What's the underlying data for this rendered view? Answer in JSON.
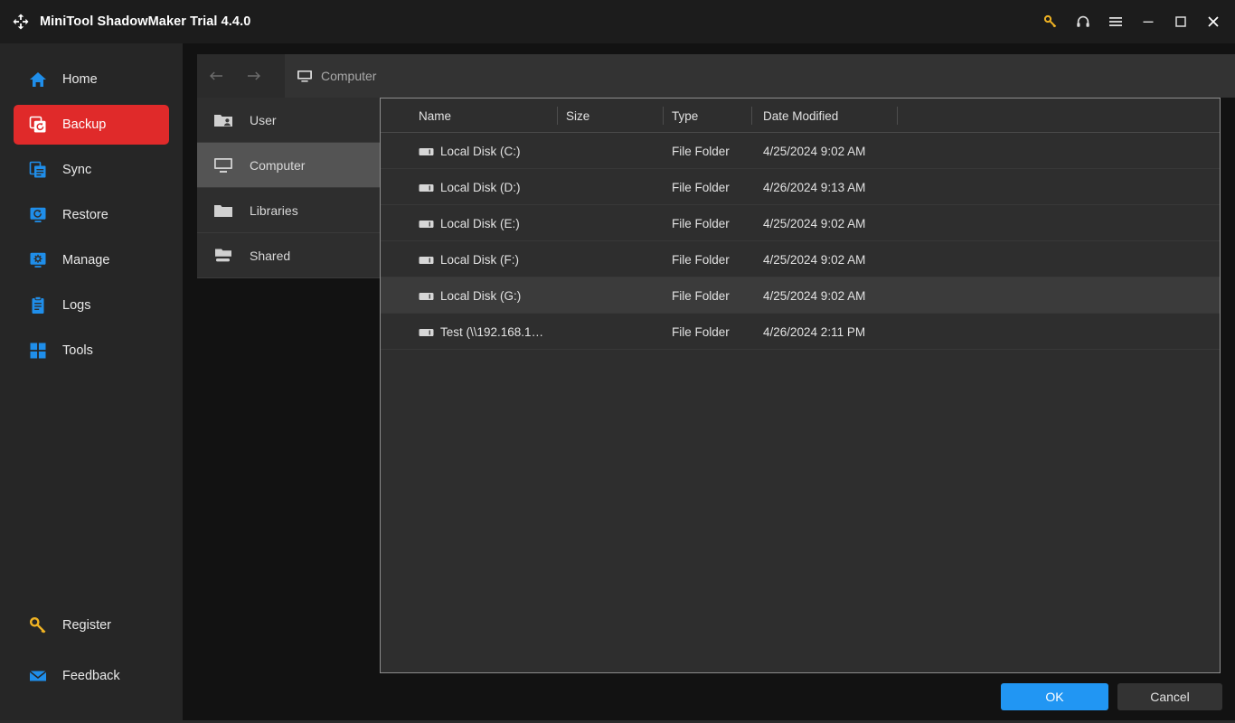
{
  "window": {
    "title": "MiniTool ShadowMaker Trial 4.4.0",
    "logo_icon": "refresh-arrows-icon",
    "controls": [
      {
        "name": "key-icon",
        "label": "Register",
        "color": "#f0b323"
      },
      {
        "name": "headset-icon",
        "label": "Support",
        "color": "#dcdcdc"
      },
      {
        "name": "hamburger-icon",
        "label": "Menu",
        "color": "#dcdcdc"
      },
      {
        "name": "minimize-icon",
        "label": "Minimize",
        "color": "#dcdcdc"
      },
      {
        "name": "maximize-icon",
        "label": "Maximize",
        "color": "#dcdcdc"
      },
      {
        "name": "close-icon",
        "label": "Close",
        "color": "#ffffff"
      }
    ]
  },
  "sidebar": {
    "items": [
      {
        "label": "Home",
        "icon": "home-icon",
        "active": false
      },
      {
        "label": "Backup",
        "icon": "backup-icon",
        "active": true
      },
      {
        "label": "Sync",
        "icon": "sync-icon",
        "active": false
      },
      {
        "label": "Restore",
        "icon": "restore-icon",
        "active": false
      },
      {
        "label": "Manage",
        "icon": "manage-icon",
        "active": false
      },
      {
        "label": "Logs",
        "icon": "logs-icon",
        "active": false
      },
      {
        "label": "Tools",
        "icon": "tools-icon",
        "active": false
      }
    ],
    "bottom_items": [
      {
        "label": "Register",
        "icon": "key-icon"
      },
      {
        "label": "Feedback",
        "icon": "envelope-icon"
      }
    ],
    "active_color": "#e02a2a",
    "icon_color": "#1f8eea"
  },
  "navbar": {
    "back_icon": "arrow-left-icon",
    "forward_icon": "arrow-right-icon",
    "path_icon": "monitor-icon",
    "path_text": "Computer"
  },
  "tree": {
    "items": [
      {
        "label": "User",
        "icon": "folder-user-icon",
        "selected": false
      },
      {
        "label": "Computer",
        "icon": "monitor-icon",
        "selected": true
      },
      {
        "label": "Libraries",
        "icon": "folder-icon",
        "selected": false
      },
      {
        "label": "Shared",
        "icon": "shared-folder-icon",
        "selected": false
      }
    ]
  },
  "filelist": {
    "columns": [
      "Name",
      "Size",
      "Type",
      "Date Modified"
    ],
    "rows": [
      {
        "name": "Local Disk (C:)",
        "size": "",
        "type": "File Folder",
        "date": "4/25/2024 9:02 AM",
        "icon": "hard-drive-icon",
        "hover": false
      },
      {
        "name": "Local Disk (D:)",
        "size": "",
        "type": "File Folder",
        "date": "4/26/2024 9:13 AM",
        "icon": "hard-drive-icon",
        "hover": false
      },
      {
        "name": "Local Disk (E:)",
        "size": "",
        "type": "File Folder",
        "date": "4/25/2024 9:02 AM",
        "icon": "hard-drive-icon",
        "hover": false
      },
      {
        "name": "Local Disk (F:)",
        "size": "",
        "type": "File Folder",
        "date": "4/25/2024 9:02 AM",
        "icon": "hard-drive-icon",
        "hover": false
      },
      {
        "name": "Local Disk (G:)",
        "size": "",
        "type": "File Folder",
        "date": "4/25/2024 9:02 AM",
        "icon": "hard-drive-icon",
        "hover": true
      },
      {
        "name": "Test (\\\\192.168.1…",
        "size": "",
        "type": "File Folder",
        "date": "4/26/2024 2:11 PM",
        "icon": "hard-drive-icon",
        "hover": false
      }
    ]
  },
  "footer": {
    "ok_label": "OK",
    "cancel_label": "Cancel",
    "ok_color": "#2196f3"
  }
}
